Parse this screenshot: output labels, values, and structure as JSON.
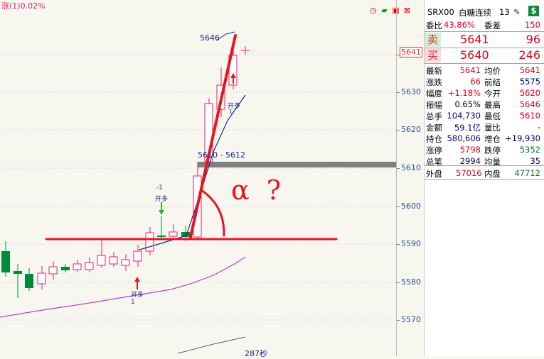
{
  "header": {
    "label": "涨(1)0.02%"
  },
  "price_axis": {
    "labels": [
      "5641",
      "5630",
      "5620",
      "5610",
      "5600",
      "5590",
      "5580",
      "5570"
    ]
  },
  "chart_annotations": {
    "high_label": "5646",
    "range_label": "5610 - 5612",
    "open_long_mid": "开多",
    "open_long_mid_num": "1",
    "open_long_left": "开多",
    "open_long_left_num": "1",
    "open_long_top": "开多",
    "open_long_top_num": "-1",
    "seconds_label": "287秒",
    "handwriting": "α ?"
  },
  "quote": {
    "symbol": "SRX00",
    "name": "白糖连续",
    "period": "13",
    "ratio_label": "委比",
    "ratio_value": "43.86%",
    "diff_label": "委差",
    "diff_value": "150",
    "sell_label": "卖",
    "sell_price": "5641",
    "sell_vol": "96",
    "buy_label": "买",
    "buy_price": "5640",
    "buy_vol": "246",
    "rows": [
      {
        "l1": "最新",
        "v1": "5641",
        "c1": "red",
        "l2": "均价",
        "v2": "5641",
        "c2": "red"
      },
      {
        "l1": "涨跌",
        "v1": "66",
        "c1": "red",
        "l2": "前结",
        "v2": "5575",
        "c2": "navy"
      },
      {
        "l1": "幅度",
        "v1": "+1.18%",
        "c1": "red",
        "l2": "今开",
        "v2": "5620",
        "c2": "red"
      },
      {
        "l1": "振幅",
        "v1": "0.65%",
        "c1": "black",
        "l2": "最高",
        "v2": "5646",
        "c2": "red"
      },
      {
        "l1": "总手",
        "v1": "104,730",
        "c1": "navy",
        "l2": "最低",
        "v2": "5610",
        "c2": "red"
      },
      {
        "l1": "金额",
        "v1": "59.1亿",
        "c1": "navy",
        "l2": "量比",
        "v2": "-",
        "c2": "black"
      },
      {
        "l1": "持仓",
        "v1": "580,606",
        "c1": "navy",
        "l2": "增仓",
        "v2": "+19,930",
        "c2": "navy"
      },
      {
        "l1": "涨停",
        "v1": "5798",
        "c1": "red",
        "l2": "跌停",
        "v2": "5352",
        "c2": "green"
      },
      {
        "l1": "总笔",
        "v1": "2994",
        "c1": "navy",
        "l2": "均量",
        "v2": "35",
        "c2": "navy"
      }
    ],
    "outer_label": "外盘",
    "outer_value": "57016",
    "inner_label": "内盘",
    "inner_value": "47712"
  },
  "colors": {
    "up": "#e0206f",
    "down": "#008a3a",
    "accent_red": "#e8141b",
    "ma_navy": "#1a2a8a",
    "ma_magenta": "#c040c0"
  },
  "icons": [
    "clock-icon",
    "toolbar-green-icon",
    "settings-icon",
    "close-icon"
  ]
}
